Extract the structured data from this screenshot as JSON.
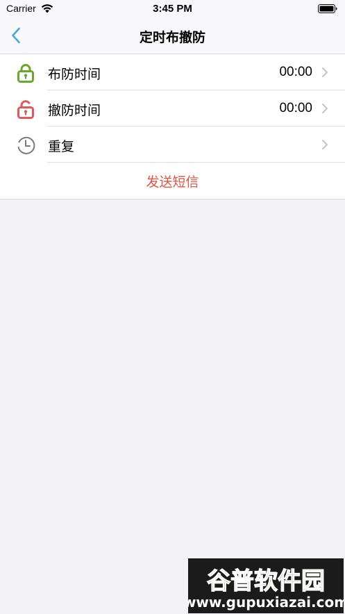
{
  "status_bar": {
    "carrier": "Carrier",
    "time": "3:45 PM"
  },
  "nav": {
    "title": "定时布撤防",
    "back_icon": "chevron-left-icon"
  },
  "rows": [
    {
      "label": "布防时间",
      "value": "00:00",
      "icon": "lock-closed-icon",
      "icon_color": "#6aa829"
    },
    {
      "label": "撤防时间",
      "value": "00:00",
      "icon": "lock-open-icon",
      "icon_color": "#e2575a"
    },
    {
      "label": "重复",
      "value": "",
      "icon": "clock-icon",
      "icon_color": "#7a7a7a"
    }
  ],
  "send_button": {
    "label": "发送短信",
    "color": "#e9533f"
  },
  "watermark": {
    "name": "谷普软件园",
    "url": "www.gupuxiazai.com"
  },
  "colors": {
    "accent": "#4aa6dd",
    "background": "#f2f2f7"
  }
}
